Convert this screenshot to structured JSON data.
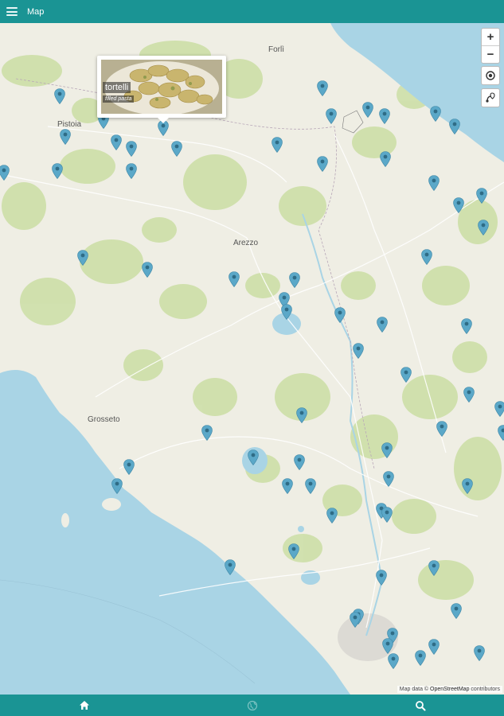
{
  "appbar": {
    "title": "Map",
    "menu_icon": "hamburger-menu-icon"
  },
  "map": {
    "cities": [
      "Forlì",
      "Pistoia",
      "Arezzo",
      "Grosseto"
    ],
    "controls": {
      "zoom_in": "+",
      "zoom_out": "−",
      "locate_icon": "target-icon",
      "route_icon": "route-icon"
    },
    "popup": {
      "name": "tortelli",
      "category": "filled pasta"
    },
    "attribution": {
      "prefix": "Map data ©",
      "link": "OpenStreetMap",
      "suffix": "contributors"
    },
    "marker_color": "#5ba8c8",
    "marker_count": 72
  },
  "bottom_nav": {
    "tabs": [
      {
        "name": "home",
        "icon": "home-icon",
        "active": true
      },
      {
        "name": "globe",
        "icon": "globe-icon",
        "active": false
      },
      {
        "name": "search",
        "icon": "search-icon",
        "active": false
      }
    ]
  },
  "colors": {
    "header": "#1a9494",
    "water": "#a9d4e5",
    "land": "#efeee4",
    "forest": "#cddfa8"
  }
}
